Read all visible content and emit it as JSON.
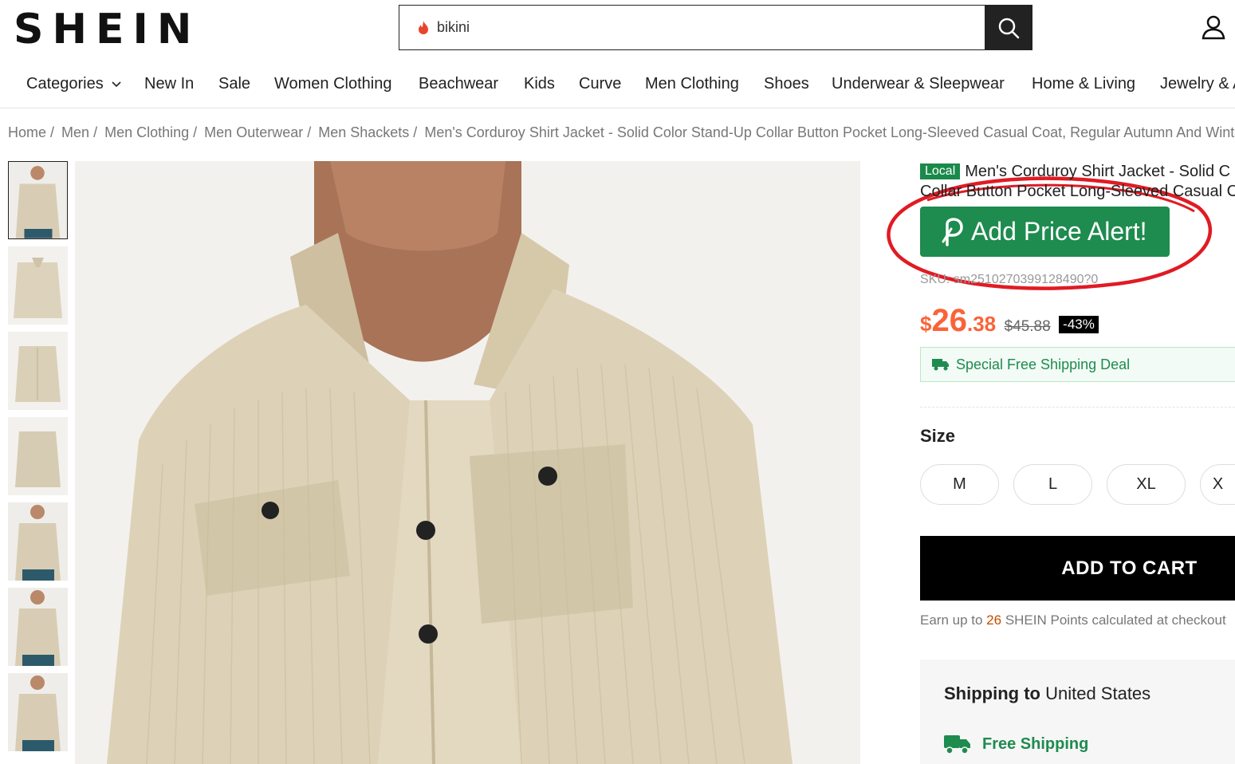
{
  "header": {
    "logo": "SHEIN",
    "search_value": "bikini",
    "icons": {
      "search": "search-icon",
      "user": "user-icon",
      "flame": "flame-icon"
    }
  },
  "nav": {
    "items": [
      "Categories",
      "New In",
      "Sale",
      "Women Clothing",
      "Beachwear",
      "Kids",
      "Curve",
      "Men Clothing",
      "Shoes",
      "Underwear & Sleepwear",
      "Home & Living",
      "Jewelry & A"
    ]
  },
  "breadcrumb": {
    "items": [
      "Home /",
      "Men /",
      "Men Clothing /",
      "Men Outerwear /",
      "Men Shackets /",
      "Men's Corduroy Shirt Jacket - Solid Color Stand-Up Collar Button Pocket Long-Sleeved Casual Coat, Regular Autumn And Winter"
    ]
  },
  "product": {
    "badge": "Local",
    "title_line1": "Men's Corduroy Shirt Jacket - Solid C",
    "title_line2": "Collar Button Pocket Long-Sleeved Casual C",
    "price_alert_label": "Add Price Alert!",
    "sku": "SKU: sm2510270399128490?0",
    "price_currency": "$",
    "price_int": "26",
    "price_dec": ".38",
    "price_original": "$45.88",
    "discount": "-43%",
    "shipping_deal": "Special Free Shipping Deal",
    "size_label": "Size",
    "sizes": [
      "M",
      "L",
      "XL",
      "X"
    ],
    "add_to_cart": "ADD TO CART",
    "points_prefix": "Earn up to ",
    "points_value": "26",
    "points_suffix": " SHEIN Points calculated at checkout",
    "shipping_to_label": "Shipping to",
    "shipping_to_country": "United States",
    "free_shipping": "Free Shipping"
  },
  "colors": {
    "brand_green": "#1e8b4f",
    "price_orange": "#fa6338",
    "highlight_red": "#e01b24"
  }
}
